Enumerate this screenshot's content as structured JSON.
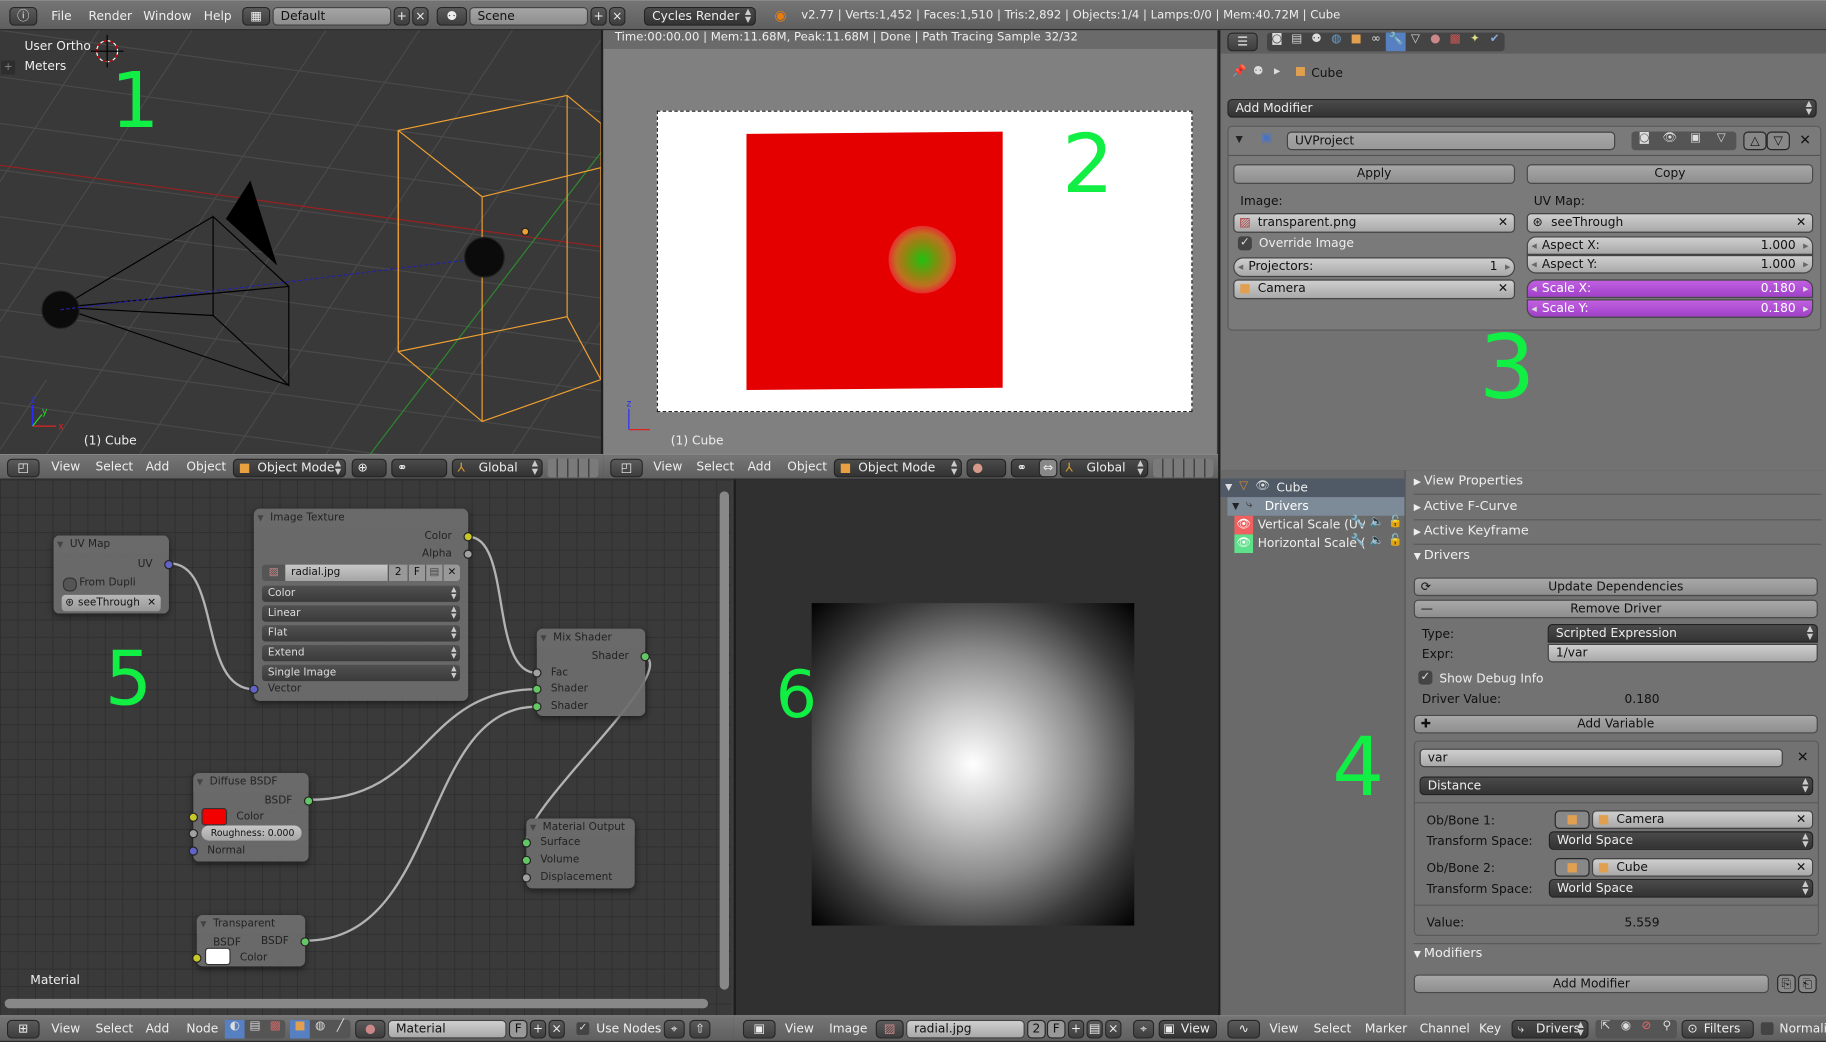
{
  "topbar": {
    "menus": [
      "File",
      "Render",
      "Window",
      "Help"
    ],
    "screen_layout": "Default",
    "scene": "Scene",
    "render_engine": "Cycles Render",
    "stats": "v2.77 | Verts:1,452 | Faces:1,510 | Tris:2,892 | Objects:1/4 | Lamps:0/0 | Mem:40.72M | Cube"
  },
  "viewport3d": {
    "view_name": "User Ortho",
    "units": "Meters",
    "object_label": "(1) Cube",
    "menus": [
      "View",
      "Select",
      "Add",
      "Object"
    ],
    "mode": "Object Mode",
    "orientation": "Global",
    "annotation": "1"
  },
  "camera_view": {
    "render_info": "Time:00:00.00 | Mem:11.68M, Peak:11.68M | Done | Path Tracing Sample 32/32",
    "object_label": "(1) Cube",
    "menus": [
      "View",
      "Select",
      "Add",
      "Object"
    ],
    "mode": "Object Mode",
    "orientation": "Global",
    "annotation": "2"
  },
  "properties": {
    "breadcrumb_object": "Cube",
    "add_modifier": "Add Modifier",
    "modifier_name": "UVProject",
    "apply": "Apply",
    "copy": "Copy",
    "image_label": "Image:",
    "image_value": "transparent.png",
    "override_image": "Override Image",
    "projectors_label": "Projectors:",
    "projectors_value": "1",
    "projector_object": "Camera",
    "uvmap_label": "UV Map:",
    "uvmap_value": "seeThrough",
    "aspect_x_label": "Aspect X:",
    "aspect_x_value": "1.000",
    "aspect_y_label": "Aspect Y:",
    "aspect_y_value": "1.000",
    "scale_x_label": "Scale X:",
    "scale_x_value": "0.180",
    "scale_y_label": "Scale Y:",
    "scale_y_value": "0.180",
    "annotation": "3"
  },
  "node_editor": {
    "nodes": {
      "uvmap": {
        "title": "UV Map",
        "output": "UV",
        "from_dupli": "From Dupli",
        "uvmap": "seeThrough"
      },
      "image_texture": {
        "title": "Image Texture",
        "out_color": "Color",
        "out_alpha": "Alpha",
        "image": "radial.jpg",
        "users": "2",
        "fake": "F",
        "color_space": "Color",
        "interpolation": "Linear",
        "projection": "Flat",
        "extension": "Extend",
        "source": "Single Image",
        "in_vector": "Vector"
      },
      "mix_shader": {
        "title": "Mix Shader",
        "output": "Shader",
        "fac": "Fac",
        "shader1": "Shader",
        "shader2": "Shader"
      },
      "diffuse": {
        "title": "Diffuse BSDF",
        "output": "BSDF",
        "color": "Color",
        "roughness": "Roughness:",
        "roughness_value": "0.000",
        "normal": "Normal"
      },
      "transparent": {
        "title": "Transparent BSDF",
        "output": "BSDF",
        "color": "Color"
      },
      "output": {
        "title": "Material Output",
        "surface": "Surface",
        "volume": "Volume",
        "displacement": "Displacement"
      }
    },
    "material_label": "Material",
    "menus": [
      "View",
      "Select",
      "Add",
      "Node"
    ],
    "material": "Material",
    "fake_user": "F",
    "use_nodes": "Use Nodes",
    "annotation": "5"
  },
  "image_editor": {
    "menus": [
      "View",
      "Image"
    ],
    "image": "radial.jpg",
    "users": "2",
    "fake": "F",
    "view_label": "View",
    "annotation": "6"
  },
  "drivers": {
    "tree": {
      "object": "Cube",
      "drivers": "Drivers",
      "channel1": "Vertical Scale (UVProject)",
      "channel2": "Horizontal Scale (UVProject)"
    },
    "panels": {
      "view_properties": "View Properties",
      "active_fcurve": "Active F-Curve",
      "active_keyframe": "Active Keyframe",
      "drivers": "Drivers",
      "modifiers": "Modifiers"
    },
    "update_dependencies": "Update Dependencies",
    "remove_driver": "Remove Driver",
    "type_label": "Type:",
    "type_value": "Scripted Expression",
    "expr_label": "Expr:",
    "expr_value": "1/var",
    "show_debug": "Show Debug Info",
    "driver_value_label": "Driver Value:",
    "driver_value": "0.180",
    "add_variable": "Add Variable",
    "var_name": "var",
    "var_type": "Distance",
    "ob1_label": "Ob/Bone 1:",
    "ob1_value": "Camera",
    "ts1_label": "Transform Space:",
    "ts1_value": "World Space",
    "ob2_label": "Ob/Bone 2:",
    "ob2_value": "Cube",
    "ts2_label": "Transform Space:",
    "ts2_value": "World Space",
    "value_label": "Value:",
    "value": "5.559",
    "add_modifier": "Add Modifier",
    "menus": [
      "View",
      "Select",
      "Marker",
      "Channel",
      "Key"
    ],
    "mode": "Drivers",
    "filters": "Filters",
    "normalize": "Normalize",
    "annotation": "4"
  }
}
